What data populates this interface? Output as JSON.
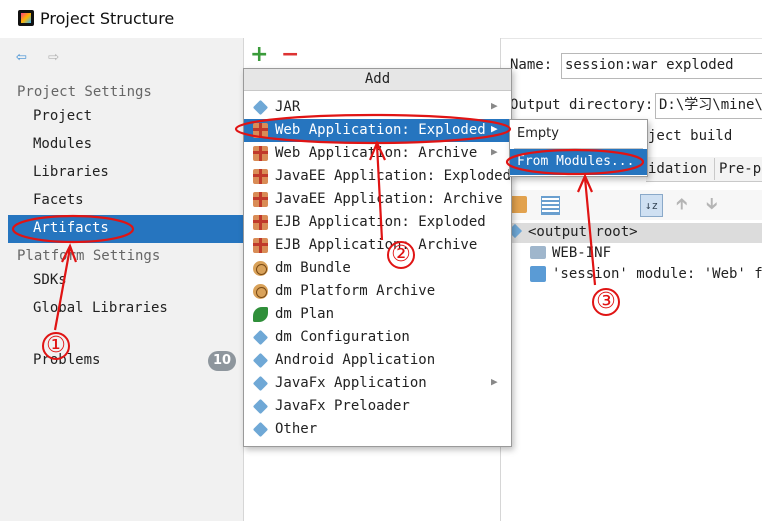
{
  "window": {
    "title": "Project Structure",
    "icon": "intellij-icon"
  },
  "left_panel": {
    "back_icon": "back-arrow-icon",
    "forward_icon": "forward-arrow-icon",
    "project_settings_header": "Project Settings",
    "project_settings_items": [
      "Project",
      "Modules",
      "Libraries",
      "Facets",
      "Artifacts"
    ],
    "selected_item": "Artifacts",
    "platform_settings_header": "Platform Settings",
    "platform_settings_items": [
      "SDKs",
      "Global Libraries"
    ],
    "problems_label": "Problems",
    "problems_count": "10"
  },
  "toolbar": {
    "add_icon": "+",
    "remove_icon": "−"
  },
  "add_menu": {
    "header": "Add",
    "items": [
      {
        "label": "JAR",
        "icon": "jar-icon",
        "submenu": true
      },
      {
        "label": "Web Application: Exploded",
        "icon": "gift-icon",
        "submenu": true,
        "selected": true
      },
      {
        "label": "Web Application: Archive",
        "icon": "gift-icon",
        "submenu": true
      },
      {
        "label": "JavaEE Application: Exploded",
        "icon": "gift-icon",
        "submenu": false
      },
      {
        "label": "JavaEE Application: Archive",
        "icon": "gift-icon",
        "submenu": false
      },
      {
        "label": "EJB Application: Exploded",
        "icon": "gift-icon",
        "submenu": false
      },
      {
        "label": "EJB Application: Archive",
        "icon": "gift-icon",
        "submenu": false
      },
      {
        "label": "dm Bundle",
        "icon": "globe-icon",
        "submenu": false
      },
      {
        "label": "dm Platform Archive",
        "icon": "globe-icon",
        "submenu": false
      },
      {
        "label": "dm Plan",
        "icon": "leaf-icon",
        "submenu": false
      },
      {
        "label": "dm Configuration",
        "icon": "diamond-icon",
        "submenu": false
      },
      {
        "label": "Android Application",
        "icon": "diamond-icon",
        "submenu": false
      },
      {
        "label": "JavaFx Application",
        "icon": "diamond-icon",
        "submenu": true
      },
      {
        "label": "JavaFx Preloader",
        "icon": "diamond-icon",
        "submenu": false
      },
      {
        "label": "Other",
        "icon": "diamond-icon",
        "submenu": false
      }
    ]
  },
  "submenu": {
    "items": [
      "Empty",
      "From Modules..."
    ],
    "selected": "From Modules..."
  },
  "right_panel": {
    "name_label": "Name:",
    "name_value": "session:war exploded",
    "output_dir_label": "Output directory:",
    "output_dir_value": "D:\\学习\\mine\\",
    "build_on_make_text": "ject build",
    "tabs": [
      "idation",
      "Pre-p"
    ],
    "output_root": "<output root>",
    "tree_items": [
      "WEB-INF",
      "'session' module: 'Web' fac"
    ]
  },
  "annotations": {
    "marker_1": "①",
    "marker_2": "②",
    "marker_3": "③",
    "color": "#e01414"
  }
}
